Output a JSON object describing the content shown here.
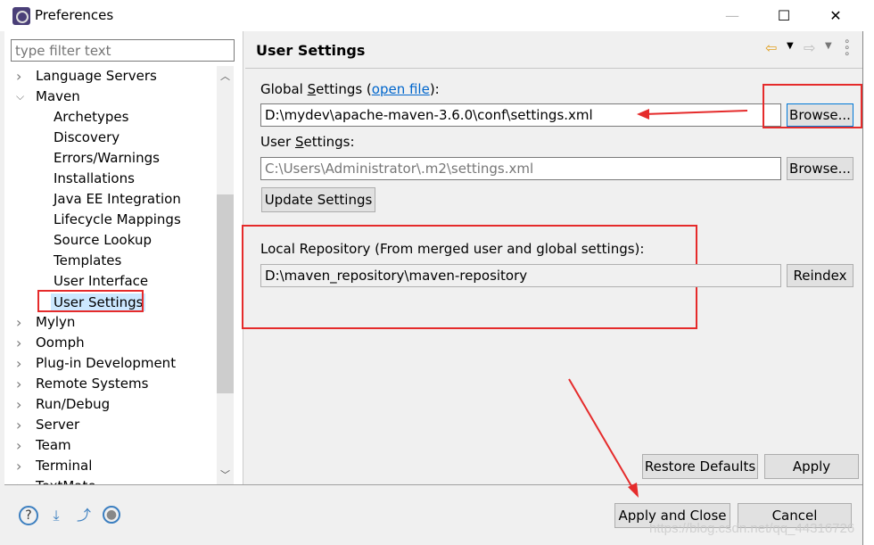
{
  "window": {
    "title": "Preferences",
    "icon": "eclipse-gear-icon"
  },
  "filter": {
    "placeholder": "type filter text"
  },
  "tree": [
    {
      "label": "Language Servers",
      "level": 0,
      "state": "collapsed"
    },
    {
      "label": "Maven",
      "level": 0,
      "state": "expanded"
    },
    {
      "label": "Archetypes",
      "level": 1
    },
    {
      "label": "Discovery",
      "level": 1
    },
    {
      "label": "Errors/Warnings",
      "level": 1
    },
    {
      "label": "Installations",
      "level": 1
    },
    {
      "label": "Java EE Integration",
      "level": 1
    },
    {
      "label": "Lifecycle Mappings",
      "level": 1
    },
    {
      "label": "Source Lookup",
      "level": 1
    },
    {
      "label": "Templates",
      "level": 1
    },
    {
      "label": "User Interface",
      "level": 1
    },
    {
      "label": "User Settings",
      "level": 1,
      "selected": true
    },
    {
      "label": "Mylyn",
      "level": 0,
      "state": "collapsed"
    },
    {
      "label": "Oomph",
      "level": 0,
      "state": "collapsed"
    },
    {
      "label": "Plug-in Development",
      "level": 0,
      "state": "collapsed"
    },
    {
      "label": "Remote Systems",
      "level": 0,
      "state": "collapsed"
    },
    {
      "label": "Run/Debug",
      "level": 0,
      "state": "collapsed"
    },
    {
      "label": "Server",
      "level": 0,
      "state": "collapsed"
    },
    {
      "label": "Team",
      "level": 0,
      "state": "collapsed"
    },
    {
      "label": "Terminal",
      "level": 0,
      "state": "collapsed"
    },
    {
      "label": "TextMate",
      "level": 0,
      "state": "collapsed"
    }
  ],
  "page": {
    "title": "User Settings",
    "global_label_pre": "Global ",
    "global_label_u": "S",
    "global_label_post": "ettings (",
    "open_file": "open file",
    "global_label_end": "):",
    "global_value": "D:\\mydev\\apache-maven-3.6.0\\conf\\settings.xml",
    "browse": "Browse...",
    "user_label_pre": "User ",
    "user_label_u": "S",
    "user_label_post": "ettings:",
    "user_value": "C:\\Users\\Administrator\\.m2\\settings.xml",
    "update": "Update Settings",
    "local_label": "Local Repository (From merged user and global settings):",
    "local_value": "D:\\maven_repository\\maven-repository",
    "reindex": "Reindex",
    "restore": "Restore Defaults",
    "apply": "Apply"
  },
  "footer": {
    "apply_close": "Apply and Close",
    "cancel": "Cancel",
    "icons": [
      "help-icon",
      "import-icon",
      "export-icon",
      "record-icon"
    ]
  },
  "watermark": "https://blog.csdn.net/qq_44316726",
  "colors": {
    "annotation": "#e52b2b",
    "link": "#0066cc",
    "selection": "#cce8ff"
  }
}
